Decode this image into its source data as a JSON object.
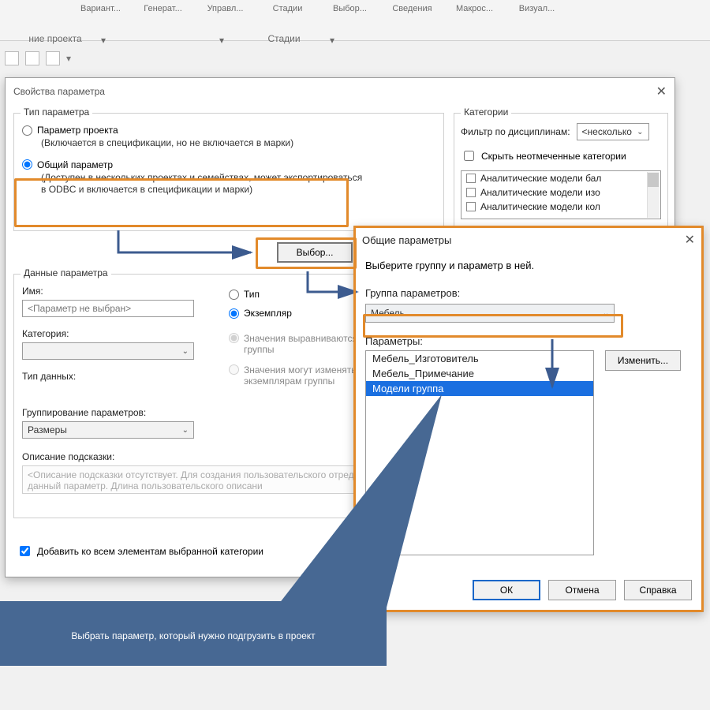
{
  "ribbon": {
    "buttons": [
      "Вариант...",
      "Генерат...",
      "Управл...",
      "Стадии",
      "Выбор...",
      "Сведения",
      "Макрос...",
      "Визуал..."
    ],
    "panels": [
      "ние проекта",
      "",
      "Стадии"
    ]
  },
  "dialog1": {
    "title": "Свойства параметра",
    "groups": {
      "param_type": {
        "title": "Тип параметра",
        "opt1": "Параметр проекта",
        "opt1_sub": "(Включается в спецификации, но не включается в марки)",
        "opt2": "Общий параметр",
        "opt2_sub": "(Доступен в нескольких проектах и семействах, может экспортироваться в ODBC и включается в спецификации и марки)",
        "choose_btn": "Выбор..."
      },
      "param_data": {
        "title": "Данные параметра",
        "name_lbl": "Имя:",
        "name_ph": "<Параметр не выбран>",
        "cat_lbl": "Категория:",
        "dtype_lbl": "Тип данных:",
        "group_lbl": "Группирование параметров:",
        "group_val": "Размеры",
        "tip_lbl": "Описание подсказки:",
        "tip_ph": "<Описание подсказки отсутствует. Для создания пользовательского  отредактируйте данный параметр. Длина пользовательского описани",
        "r_type": "Тип",
        "r_inst": "Экземпляр",
        "r_align": "Значения выравниваются по типа группы",
        "r_vary": "Значения могут изменяться по экземплярам группы"
      },
      "categories": {
        "title": "Категории",
        "filter_lbl": "Фильтр по дисциплинам:",
        "filter_val": "<несколько",
        "hide_cb": "Скрыть неотмеченные категории",
        "items": [
          "Аналитические модели бал",
          "Аналитические модели изо",
          "Аналитические модели кол"
        ]
      }
    },
    "add_all_cb": "Добавить ко всем элементам выбранной категории"
  },
  "dialog2": {
    "title": "Общие параметры",
    "instr": "Выберите группу и параметр в ней.",
    "group_lbl": "Группа параметров:",
    "group_val": "Мебель",
    "params_lbl": "Параметры:",
    "params": [
      "Мебель_Изготовитель",
      "Мебель_Примечание",
      "Модели группа"
    ],
    "change_btn": "Изменить...",
    "ok": "ОК",
    "cancel": "Отмена",
    "help": "Справка"
  },
  "callout": "Выбрать параметр, который нужно подгрузить в проект"
}
